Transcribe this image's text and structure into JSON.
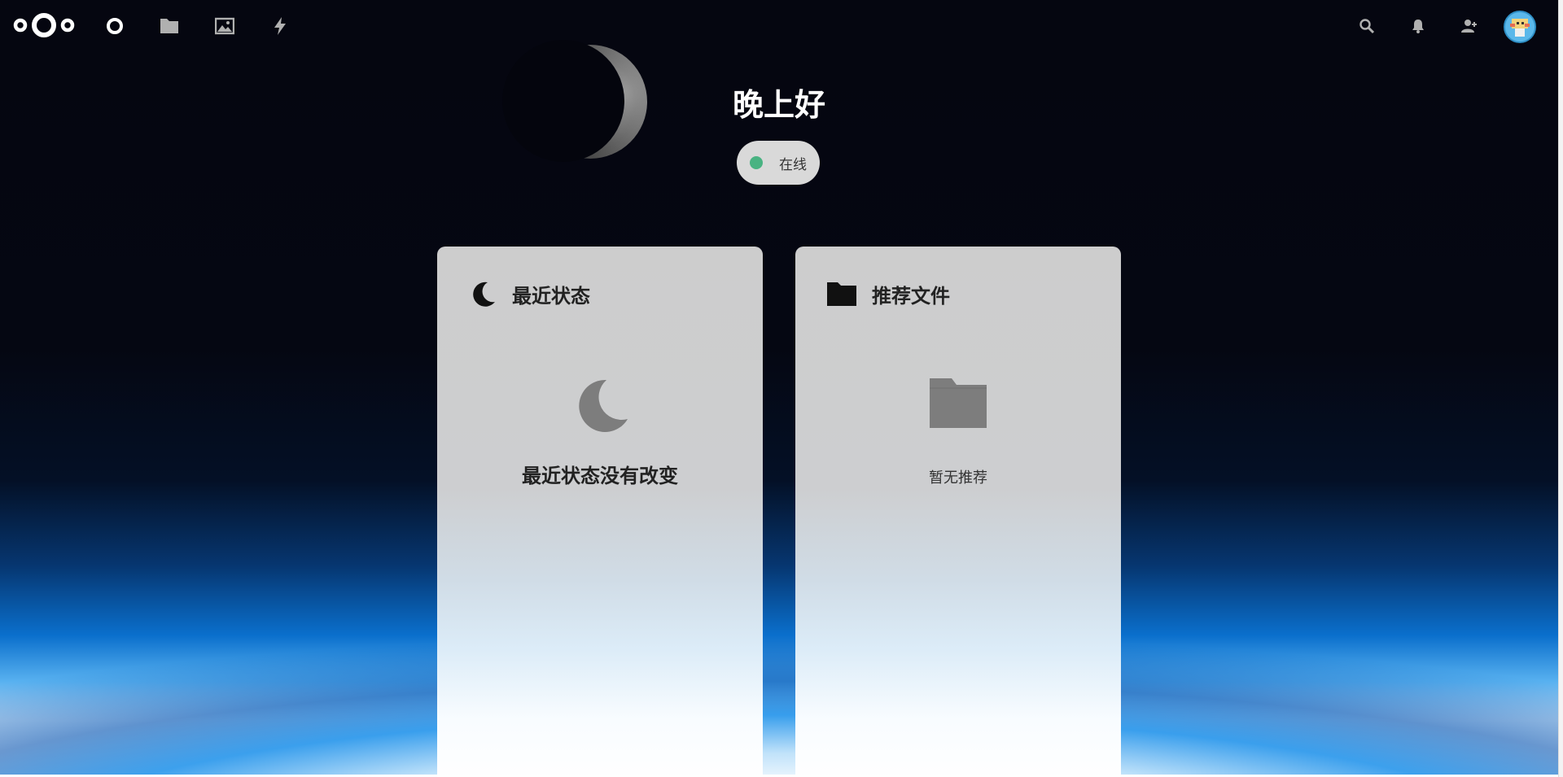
{
  "header": {
    "logo": "nextcloud-logo",
    "nav": [
      {
        "icon": "dashboard-icon",
        "name": "Dashboard"
      },
      {
        "icon": "folder-icon",
        "name": "Files"
      },
      {
        "icon": "image-icon",
        "name": "Photos"
      },
      {
        "icon": "lightning-icon",
        "name": "Activity"
      }
    ],
    "right": [
      {
        "icon": "search-icon"
      },
      {
        "icon": "bell-icon"
      },
      {
        "icon": "contacts-icon"
      },
      {
        "icon": "avatar"
      }
    ]
  },
  "greeting": "晚上好",
  "status": {
    "label": "在线",
    "color": "#49b382"
  },
  "widgets": [
    {
      "icon": "moon-icon",
      "title": "最近状态",
      "empty_icon": "moon-icon",
      "empty_text": "最近状态没有改变"
    },
    {
      "icon": "folder-icon",
      "title": "推荐文件",
      "empty_icon": "folder-icon",
      "empty_text": "暂无推荐"
    }
  ],
  "colors": {
    "online": "#49b382",
    "panel": "#cdcdcd",
    "icon_grey": "#808080"
  }
}
